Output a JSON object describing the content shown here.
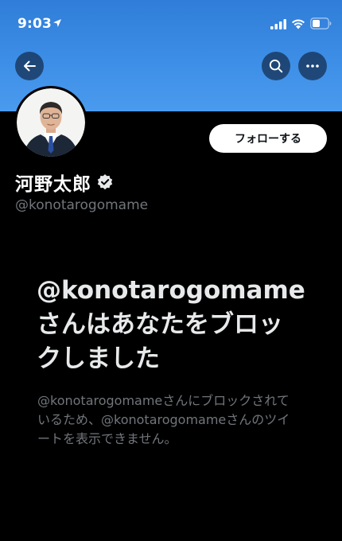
{
  "status_bar": {
    "time": "9:03",
    "icons": [
      "location-arrow-icon",
      "signal-icon",
      "wifi-icon",
      "battery-icon"
    ]
  },
  "nav": {
    "back_icon": "back-arrow-icon",
    "search_icon": "search-icon",
    "more_icon": "more-icon"
  },
  "profile": {
    "display_name": "河野太郎",
    "handle": "@konotarogomame",
    "verified": true,
    "follow_label": "フォローする",
    "banner_color": "#3d8ee6"
  },
  "blocked": {
    "title": "@konotarogomameさんはあなたをブロックしました",
    "body": "@konotarogomameさんにブロックされているため、@konotarogomameさんのツイートを表示できません。"
  },
  "colors": {
    "background": "#000000",
    "primary_text": "#e7e9ea",
    "secondary_text": "#71767b",
    "follow_button_bg": "#ffffff"
  }
}
